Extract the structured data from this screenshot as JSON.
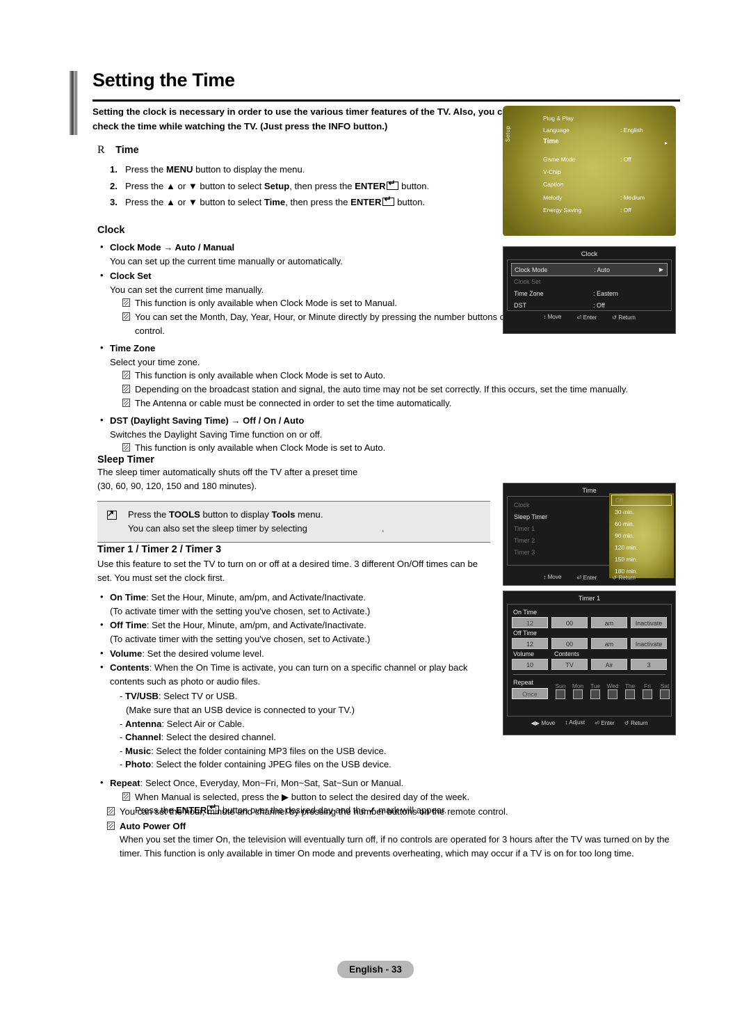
{
  "header": {
    "title": "Setting the Time",
    "subtitle": "Setting the clock is necessary in order to use the various timer features of the TV. Also, you can check the time while watching the TV. (Just press the INFO button.)"
  },
  "time_section": {
    "marker": "R",
    "heading": "Time",
    "steps": [
      {
        "num": "1.",
        "pre": "Press the ",
        "b1": "MENU",
        "post": " button to display the menu."
      },
      {
        "num": "2.",
        "pre": "Press the ▲ or ▼ button to select ",
        "b1": "Setup",
        "mid": ", then press the ",
        "b2": "ENTER",
        "post": " button."
      },
      {
        "num": "3.",
        "pre": "Press the ▲ or ▼ button to select ",
        "b1": "Time",
        "mid": ", then press the ",
        "b2": "ENTER",
        "post": " button."
      }
    ]
  },
  "clock": {
    "heading": "Clock",
    "clock_mode_title": "Clock Mode → Auto / Manual",
    "clock_mode_desc": "You can set up the current time manually or automatically.",
    "clock_set_title": "Clock Set",
    "clock_set_desc": "You can set the current time manually.",
    "clock_set_note1": "This function is only available when Clock Mode is set to Manual.",
    "clock_set_note2": "You can set the Month, Day, Year, Hour, or Minute directly by pressing the number buttons on the remote control.",
    "time_zone_title": "Time Zone",
    "time_zone_desc": "Select your time zone.",
    "time_zone_note1": "This function is only available when Clock Mode is set to Auto.",
    "time_zone_note2": "Depending on the broadcast station and signal, the auto time may not be set correctly. If this occurs, set the time manually.",
    "time_zone_note3": "The Antenna or cable must be connected in order to set the time automatically.",
    "dst_title": "DST (Daylight Saving Time) → Off / On / Auto",
    "dst_desc": "Switches the Daylight Saving Time function on or off.",
    "dst_note1": "This function is only available when Clock Mode is set to Auto."
  },
  "sleep_timer": {
    "heading": "Sleep Timer",
    "desc_line1": "The sleep timer automatically shuts off the TV after a preset time",
    "desc_line2": "(30, 60, 90, 120, 150 and 180 minutes).",
    "tools_line1_pre": "Press the ",
    "tools_line1_b1": "TOOLS",
    "tools_line1_mid": " button to display ",
    "tools_line1_b2": "Tools",
    "tools_line1_post": " menu.",
    "tools_line2": "You can also set the sleep timer by selecting",
    "tools_line2_end": "."
  },
  "timers": {
    "heading": "Timer 1 / Timer 2 / Timer 3",
    "desc": "Use this feature to set the TV to turn on or off at a desired time. 3 different On/Off times can be set. You must set the clock first.",
    "on_time_label": "On Time",
    "on_time_desc": ": Set the Hour, Minute, am/pm, and Activate/Inactivate.",
    "on_time_note": "(To activate timer with the setting you've chosen, set to Activate.)",
    "off_time_label": "Off Time",
    "off_time_desc": ": Set the Hour, Minute, am/pm, and Activate/Inactivate.",
    "off_time_note": "(To activate timer with the setting you've chosen, set to Activate.)",
    "volume_label": "Volume",
    "volume_desc": ": Set the desired volume level.",
    "contents_label": "Contents",
    "contents_desc": ": When the On Time is activate, you can turn on a specific channel or play back contents such as photo or audio files.",
    "sub": [
      {
        "label": "TV/USB",
        "desc": ": Select TV or USB.",
        "extra": "(Make sure that an USB device is connected to your TV.)"
      },
      {
        "label": "Antenna",
        "desc": ": Select Air or Cable.",
        "extra": ""
      },
      {
        "label": "Channel",
        "desc": ": Select the desired channel.",
        "extra": ""
      },
      {
        "label": "Music",
        "desc": ": Select the folder containing MP3 files on the USB device.",
        "extra": ""
      },
      {
        "label": "Photo",
        "desc": ": Select the folder containing JPEG files on the USB device.",
        "extra": ""
      }
    ],
    "repeat_label": "Repeat",
    "repeat_desc": ": Select Once, Everyday, Mon~Fri, Mon~Sat, Sat~Sun or Manual.",
    "repeat_note_l1": "When Manual is selected, press the ▶ button to select the desired day of the week.",
    "repeat_note_l2_a": "Press the ",
    "repeat_note_l2_b": "ENTER",
    "repeat_note_l2_c": " button over the desired day and the ",
    "repeat_note_l2_d": " mark will appear."
  },
  "final_notes": {
    "note1": "You can set the hour, minute and channel by pressing the number buttons on the remote control.",
    "auto_power_off_title": "Auto Power Off",
    "auto_power_off_desc": "When you set the timer On, the television will eventually turn off, if no controls are operated for 3 hours after the TV was turned on by the timer. This function is only available in timer On mode and prevents overheating, which may occur if a TV is on for too long time."
  },
  "osd_setup": {
    "tab": "Setup",
    "items": [
      {
        "label": "Plug & Play",
        "value": "",
        "highlight": false
      },
      {
        "label": "Language",
        "value": ": English",
        "highlight": false
      },
      {
        "label": "Time",
        "value": "",
        "highlight": true,
        "arrow": "▸"
      },
      {
        "label": "Game Mode",
        "value": ": Off",
        "highlight": false
      },
      {
        "label": "V-Chip",
        "value": "",
        "highlight": false
      },
      {
        "label": "Caption",
        "value": "",
        "highlight": false
      },
      {
        "label": "Melody",
        "value": ": Medium",
        "highlight": false
      },
      {
        "label": "Energy Saving",
        "value": ": Off",
        "highlight": false
      }
    ]
  },
  "osd_clock": {
    "title": "Clock",
    "rows": [
      {
        "label": "Clock Mode",
        "value": ": Auto",
        "selected": true,
        "dim": false,
        "arrow": "▶"
      },
      {
        "label": "Clock Set",
        "value": "",
        "selected": false,
        "dim": true
      },
      {
        "label": "Time Zone",
        "value": ": Eastern",
        "selected": false,
        "dim": false
      },
      {
        "label": "DST",
        "value": ": Off",
        "selected": false,
        "dim": false
      }
    ],
    "footer": [
      {
        "icon": "↕",
        "label": "Move"
      },
      {
        "icon": "⏎",
        "label": "Enter"
      },
      {
        "icon": "↺",
        "label": "Return"
      }
    ]
  },
  "osd_sleep": {
    "title": "Time",
    "left_items": [
      {
        "label": "Clock",
        "dim": true
      },
      {
        "label": "Sleep Timer",
        "dim": false
      },
      {
        "label": "Timer 1",
        "dim": true
      },
      {
        "label": "Timer 2",
        "dim": true
      },
      {
        "label": "Timer 3",
        "dim": true
      }
    ],
    "options": [
      "Off",
      "30 min.",
      "60 min.",
      "90 min.",
      "120 min.",
      "150 min.",
      "180 min."
    ],
    "selected_option": "Off",
    "footer": [
      {
        "icon": "↕",
        "label": "Move"
      },
      {
        "icon": "⏎",
        "label": "Enter"
      },
      {
        "icon": "↺",
        "label": "Return"
      }
    ]
  },
  "osd_timer1": {
    "title": "Timer 1",
    "on_time_label": "On Time",
    "on_time": {
      "hour": "12",
      "minute": "00",
      "ampm": "am",
      "state": "Inactivate"
    },
    "off_time_label": "Off Time",
    "off_time": {
      "hour": "12",
      "minute": "00",
      "ampm": "am",
      "state": "Inactivate"
    },
    "volume_label": "Volume",
    "volume_value": "10",
    "contents_label": "Contents",
    "contents_source": "TV",
    "contents_antenna": "Air",
    "contents_channel": "3",
    "repeat_label": "Repeat",
    "repeat_value": "Once",
    "days": [
      "Sun",
      "Mon",
      "Tue",
      "Wed",
      "The",
      "Fri",
      "Sat"
    ],
    "footer": [
      {
        "icon": "◀▶",
        "label": "Move"
      },
      {
        "icon": "↕",
        "label": "Adjust"
      },
      {
        "icon": "⏎",
        "label": "Enter"
      },
      {
        "icon": "↺",
        "label": "Return"
      }
    ]
  },
  "footer": {
    "page_label": "English - 33"
  }
}
